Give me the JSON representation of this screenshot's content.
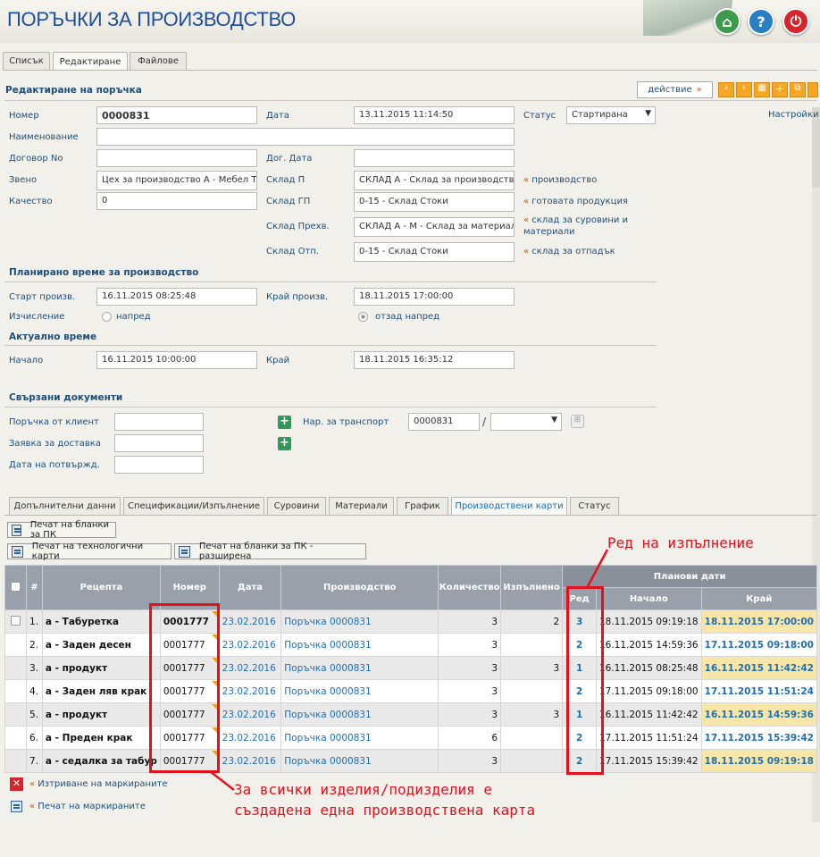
{
  "app": {
    "title": "ПОРЪЧКИ ЗА ПРОИЗВОДСТВО"
  },
  "tabs": [
    "Списък",
    "Редактиране",
    "Файлове"
  ],
  "edit": {
    "title": "Редактиране на поръчка",
    "action_label": "действие",
    "settings_label": "Настройки"
  },
  "form": {
    "number_label": "Номер",
    "number": "0000831",
    "date_label": "Дата",
    "date": "13.11.2015 11:14:50",
    "status_label": "Статус",
    "status": "Стартирана",
    "name_label": "Наименование",
    "name": "",
    "contract_label": "Договор No",
    "contract": "",
    "contract_date_label": "Дог. Дата",
    "contract_date": "",
    "unit_label": "Звено",
    "unit": "Цех за производство А - Мебел Т",
    "quality_label": "Качество",
    "quality": "0",
    "wh_p_label": "Склад П",
    "wh_p": "СКЛАД А - Склад за производство",
    "wh_gp_label": "Склад ГП",
    "wh_gp": "0-15 - Склад Стоки",
    "wh_transfer_label": "Склад Прехв.",
    "wh_transfer": "СКЛАД А - М - Склад за материал",
    "wh_waste_label": "Склад Отп.",
    "wh_waste": "0-15 - Склад Стоки",
    "link_prod": "производство",
    "link_finished": "готовата продукция",
    "link_raw": "склад за суровини и материали",
    "link_waste": "склад за отпадък"
  },
  "planned": {
    "title": "Планирано време за производство",
    "start_label": "Старт произв.",
    "start": "16.11.2015 08:25:48",
    "end_label": "Край произв.",
    "end": "18.11.2015 17:00:00",
    "calc_label": "Изчисление",
    "opt_forward": "напред",
    "opt_backward": "отзад напред"
  },
  "actual": {
    "title": "Актуално време",
    "start_label": "Начало",
    "start": "16.11.2015 10:00:00",
    "end_label": "Край",
    "end": "18.11.2015 16:35:12"
  },
  "related": {
    "title": "Свързани документи",
    "client_order_label": "Поръчка от клиент",
    "supply_label": "Заявка за доставка",
    "confirm_label": "Дата на потвържд.",
    "transport_label": "Нар. за транспорт",
    "transport_value": "0000831",
    "slash": "/"
  },
  "subtabs": [
    "Допълнителни данни",
    "Спецификации/Изпълнение",
    "Суровини",
    "Материали",
    "График",
    "Производствени карти",
    "Статус"
  ],
  "print_buttons": {
    "blanks": "Печат на бланки за ПК",
    "tech": "Печат на технологични карти",
    "blanks_ext": "Печат на бланки за ПК - разширена"
  },
  "table": {
    "headers": {
      "hash": "#",
      "recipe": "Рецепта",
      "number": "Номер",
      "date": "Дата",
      "production": "Производство",
      "quantity": "Количество",
      "done": "Изпълнено",
      "planned_dates": "Планови дати",
      "row": "Ред",
      "start": "Начало",
      "end": "Край"
    },
    "rows": [
      {
        "idx": "1.",
        "recipe": "а - Табуретка",
        "number": "0001777",
        "date": "23.02.2016",
        "production": "Поръчка 0000831",
        "qty": "3",
        "done": "2",
        "row": "3",
        "start": "18.11.2015 09:19:18",
        "end": "18.11.2015 17:00:00",
        "hl": true,
        "bold": true
      },
      {
        "idx": "2.",
        "recipe": "а - Заден десен",
        "number": "0001777",
        "date": "23.02.2016",
        "production": "Поръчка 0000831",
        "qty": "3",
        "done": "",
        "row": "2",
        "start": "16.11.2015 14:59:36",
        "end": "17.11.2015 09:18:00",
        "hl": false,
        "bold": false
      },
      {
        "idx": "3.",
        "recipe": "а - продукт",
        "number": "0001777",
        "date": "23.02.2016",
        "production": "Поръчка 0000831",
        "qty": "3",
        "done": "3",
        "row": "1",
        "start": "16.11.2015 08:25:48",
        "end": "16.11.2015 11:42:42",
        "hl": true,
        "bold": false
      },
      {
        "idx": "4.",
        "recipe": "а - Заден ляв крак",
        "number": "0001777",
        "date": "23.02.2016",
        "production": "Поръчка 0000831",
        "qty": "3",
        "done": "",
        "row": "2",
        "start": "17.11.2015 09:18:00",
        "end": "17.11.2015 11:51:24",
        "hl": false,
        "bold": false
      },
      {
        "idx": "5.",
        "recipe": "а - продукт",
        "number": "0001777",
        "date": "23.02.2016",
        "production": "Поръчка 0000831",
        "qty": "3",
        "done": "3",
        "row": "1",
        "start": "16.11.2015 11:42:42",
        "end": "16.11.2015 14:59:36",
        "hl": true,
        "bold": false
      },
      {
        "idx": "6.",
        "recipe": "а - Преден крак",
        "number": "0001777",
        "date": "23.02.2016",
        "production": "Поръчка 0000831",
        "qty": "6",
        "done": "",
        "row": "2",
        "start": "17.11.2015 11:51:24",
        "end": "17.11.2015 15:39:42",
        "hl": false,
        "bold": false
      },
      {
        "idx": "7.",
        "recipe": "а - седалка за табур",
        "number": "0001777",
        "date": "23.02.2016",
        "production": "Поръчка 0000831",
        "qty": "3",
        "done": "",
        "row": "2",
        "start": "17.11.2015 15:39:42",
        "end": "18.11.2015 09:19:18",
        "hl": true,
        "bold": false
      }
    ]
  },
  "bottom": {
    "delete_marked": "Изтриване на маркираните",
    "print_marked": "Печат на маркираните"
  },
  "annotations": {
    "row_order": "Ред на изпълнение",
    "one_card_line1": "За всички изделия/подизделия е",
    "one_card_line2": "създадена една производствена карта"
  },
  "colors": {
    "accent": "#1f4e79",
    "highlight": "#f8e6a8",
    "annotation": "#e3101e"
  }
}
